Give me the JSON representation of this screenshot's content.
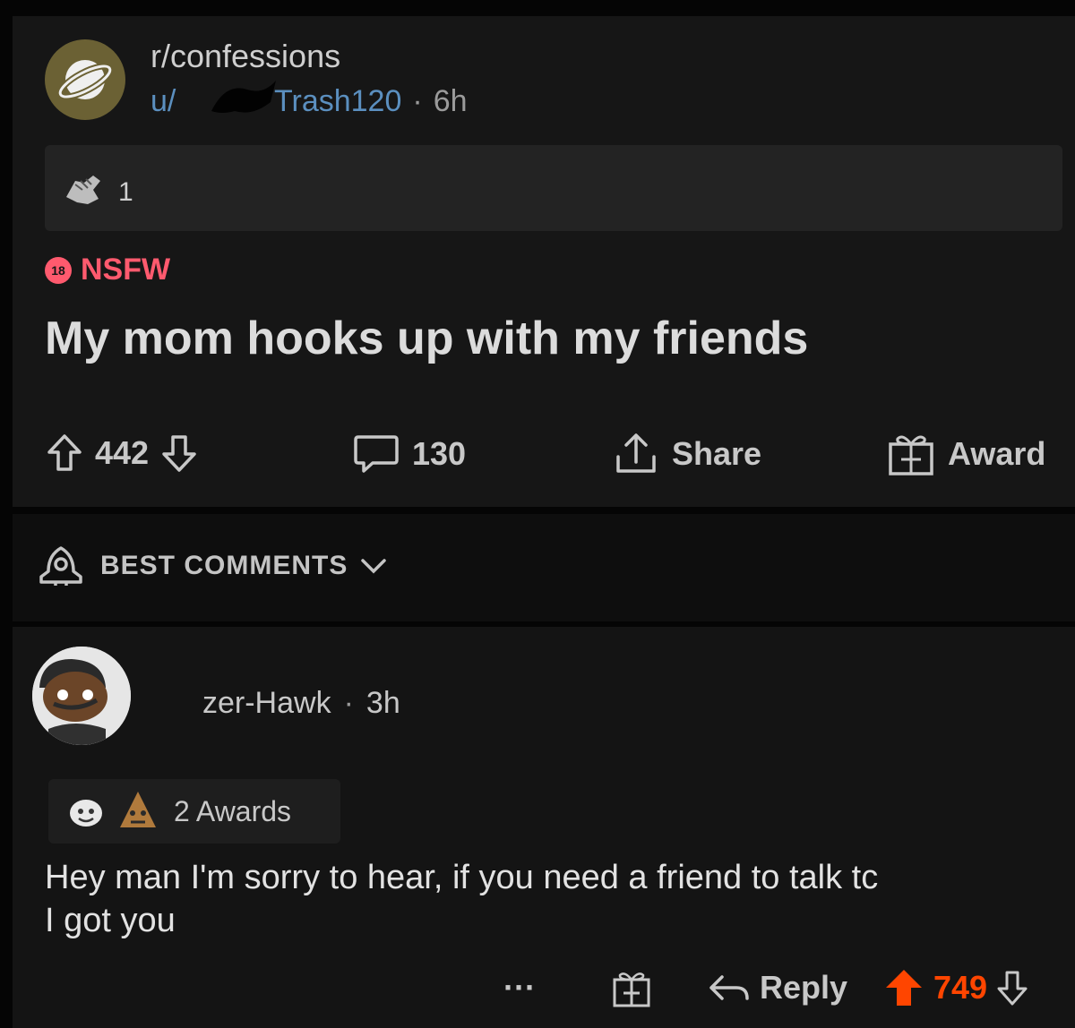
{
  "post": {
    "subreddit": "r/confessions",
    "user_prefix": "u/",
    "username": "Trash120",
    "separator": "·",
    "age": "6h",
    "award_count": "1",
    "nsfw_label": "NSFW",
    "nsfw_badge": "18",
    "title": "My mom hooks up with my friends",
    "upvotes": "442",
    "comments": "130",
    "share_label": "Share",
    "award_label": "Award"
  },
  "sort": {
    "label": "BEST COMMENTS"
  },
  "comment": {
    "author": "zer-Hawk",
    "separator": "·",
    "age": "3h",
    "awards_label": "2 Awards",
    "body_line1": "Hey man I'm sorry to hear, if you need a friend to talk tc",
    "body_line2": "I got you",
    "more": "···",
    "reply_label": "Reply",
    "score": "749"
  },
  "colors": {
    "nsfw": "#ff5a6e",
    "username_link": "#5b8fbf",
    "upvoted": "#ff4500",
    "background": "#161616"
  }
}
